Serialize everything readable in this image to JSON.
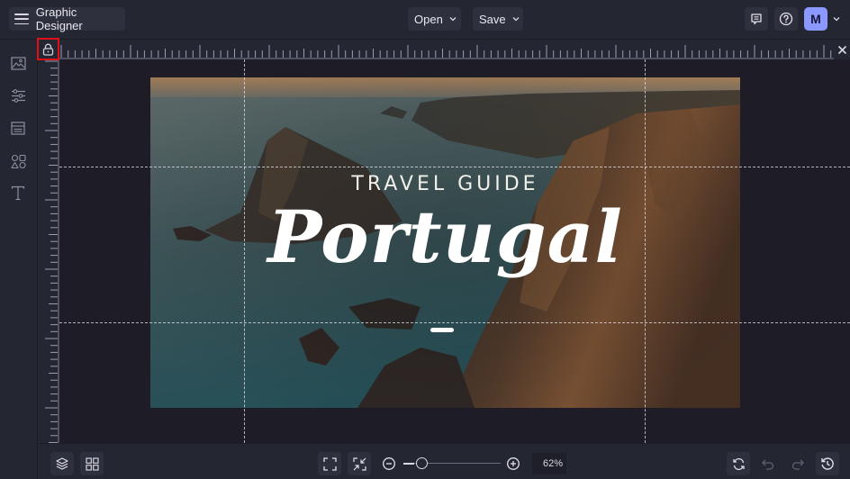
{
  "app": {
    "title": "Graphic Designer"
  },
  "toolbar": {
    "open_label": "Open",
    "save_label": "Save",
    "avatar_initial": "M",
    "avatar_color": "#8b98ff"
  },
  "sidebar": {
    "items": [
      {
        "name": "images",
        "icon": "image-icon"
      },
      {
        "name": "adjustments",
        "icon": "sliders-icon"
      },
      {
        "name": "backgrounds",
        "icon": "layout-icon"
      },
      {
        "name": "shapes",
        "icon": "shapes-icon"
      },
      {
        "name": "text",
        "icon": "text-icon"
      }
    ]
  },
  "rulers": {
    "lock_highlight_color": "#e0101a"
  },
  "design": {
    "subtitle": "TRAVEL GUIDE",
    "title": "Portugal"
  },
  "bottombar": {
    "zoom_value": "62%",
    "zoom_percent": 62
  }
}
